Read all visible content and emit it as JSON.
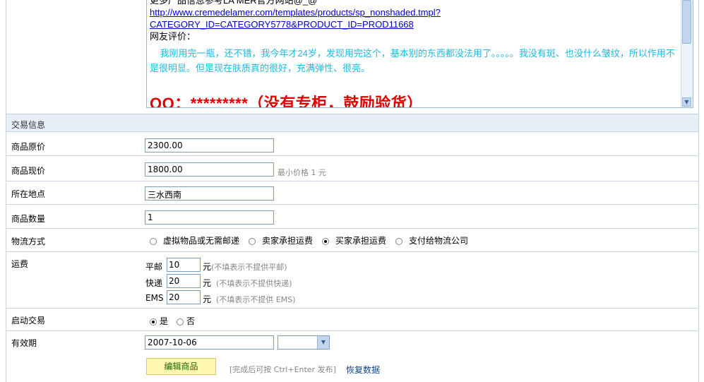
{
  "editor": {
    "top_line": "更多产品信息参考LA MER官方网站@_@",
    "link_line1": "http://www.cremedelamer.com/templates/products/sp_nonshaded.tmpl?",
    "link_line2": "CATEGORY_ID=CATEGORY5778&PRODUCT_ID=PROD11668",
    "review_label": "网友评价：",
    "review_text": "我刚用完一瓶，还不错，我今年才24岁，发现用完这个，基本别的东西都没法用了。。。。。我没有斑、也没什么皱纹，所以作用不是很明显。但是现在肤质真的很好，充满弹性、很亮。",
    "qq_text": "QQ：*********（没有专柜，鼓励验货）"
  },
  "section": {
    "title": "交易信息"
  },
  "fields": {
    "original_price": {
      "label": "商品原价",
      "value": "2300.00"
    },
    "current_price": {
      "label": "商品现价",
      "value": "1800.00",
      "hint": "最小价格 1 元"
    },
    "location": {
      "label": "所在地点",
      "value": "三水西南"
    },
    "quantity": {
      "label": "商品数量",
      "value": "1"
    },
    "shipping_method": {
      "label": "物流方式",
      "options": [
        "虚拟物品或无需邮递",
        "卖家承担运费",
        "买家承担运费",
        "支付给物流公司"
      ],
      "selected": "买家承担运费"
    },
    "shipping_fee": {
      "label": "运费",
      "unit": "元",
      "normal": {
        "label": "平邮",
        "value": "10",
        "hint": "(不填表示不提供平邮)"
      },
      "express": {
        "label": "快递",
        "value": "20",
        "hint": "(不填表示不提供快递)"
      },
      "ems": {
        "label": "EMS",
        "value": "20",
        "hint": "(不填表示不提供 EMS)"
      }
    },
    "start_trade": {
      "label": "启动交易",
      "yes": "是",
      "no": "否",
      "selected": "是"
    },
    "expiry": {
      "label": "有效期",
      "date": "2007-10-06",
      "select_value": ""
    }
  },
  "actions": {
    "edit_button": "编辑商品",
    "footnote": "[完成后可按 Ctrl+Enter 发布]",
    "restore_link": "恢复数据"
  }
}
